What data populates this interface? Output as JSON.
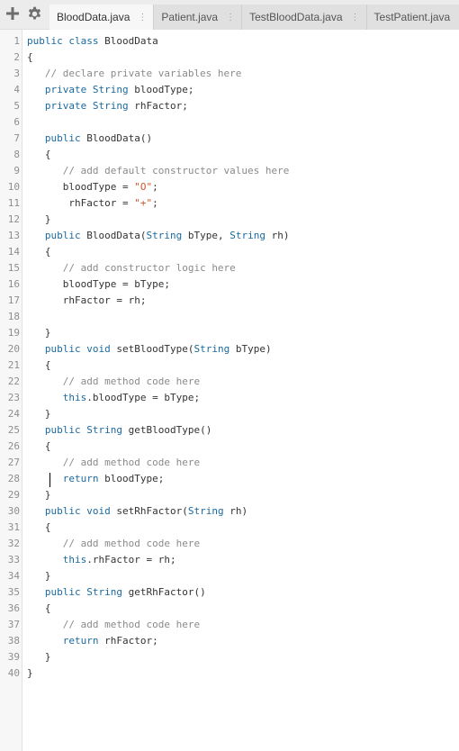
{
  "toolbar": {
    "icons": [
      {
        "name": "add-icon",
        "glyph": "+"
      },
      {
        "name": "settings-gear-icon",
        "glyph": "gear"
      }
    ]
  },
  "tabs": [
    {
      "label": "BloodData.java",
      "active": true,
      "menu": "⋮"
    },
    {
      "label": "Patient.java",
      "active": false,
      "menu": "⋮"
    },
    {
      "label": "TestBloodData.java",
      "active": false,
      "menu": "⋮"
    },
    {
      "label": "TestPatient.java",
      "active": false,
      "menu": "⋮"
    }
  ],
  "editor": {
    "line_numbers": [
      "1",
      "2",
      "3",
      "4",
      "5",
      "6",
      "7",
      "8",
      "9",
      "10",
      "11",
      "12",
      "13",
      "14",
      "15",
      "16",
      "17",
      "18",
      "19",
      "20",
      "21",
      "22",
      "23",
      "24",
      "25",
      "26",
      "27",
      "28",
      "29",
      "30",
      "31",
      "32",
      "33",
      "34",
      "35",
      "36",
      "37",
      "38",
      "39",
      "40"
    ],
    "lines": [
      "public class BloodData",
      "{",
      "   // declare private variables here",
      "   private String bloodType;",
      "   private String rhFactor;",
      "",
      "   public BloodData()",
      "   {",
      "      // add default constructor values here",
      "      bloodType = \"O\";",
      "       rhFactor = \"+\";",
      "   }",
      "   public BloodData(String bType, String rh)",
      "   {",
      "      // add constructor logic here",
      "      bloodType = bType;",
      "      rhFactor = rh;",
      "",
      "   }",
      "   public void setBloodType(String bType)",
      "   {",
      "      // add method code here",
      "      this.bloodType = bType;",
      "   }",
      "   public String getBloodType()",
      "   {",
      "      // add method code here",
      "      return bloodType;",
      "   }",
      "   public void setRhFactor(String rh)",
      "   {",
      "      // add method code here",
      "      this.rhFactor = rh;",
      "   }",
      "   public String getRhFactor()",
      "   {",
      "      // add method code here",
      "      return rhFactor;",
      "   }",
      "}"
    ]
  },
  "colors": {
    "keyword": "#1a6aa0",
    "comment": "#8a8a8a",
    "string": "#d0552a",
    "text": "#333333",
    "line_number": "#8e8e8e"
  }
}
